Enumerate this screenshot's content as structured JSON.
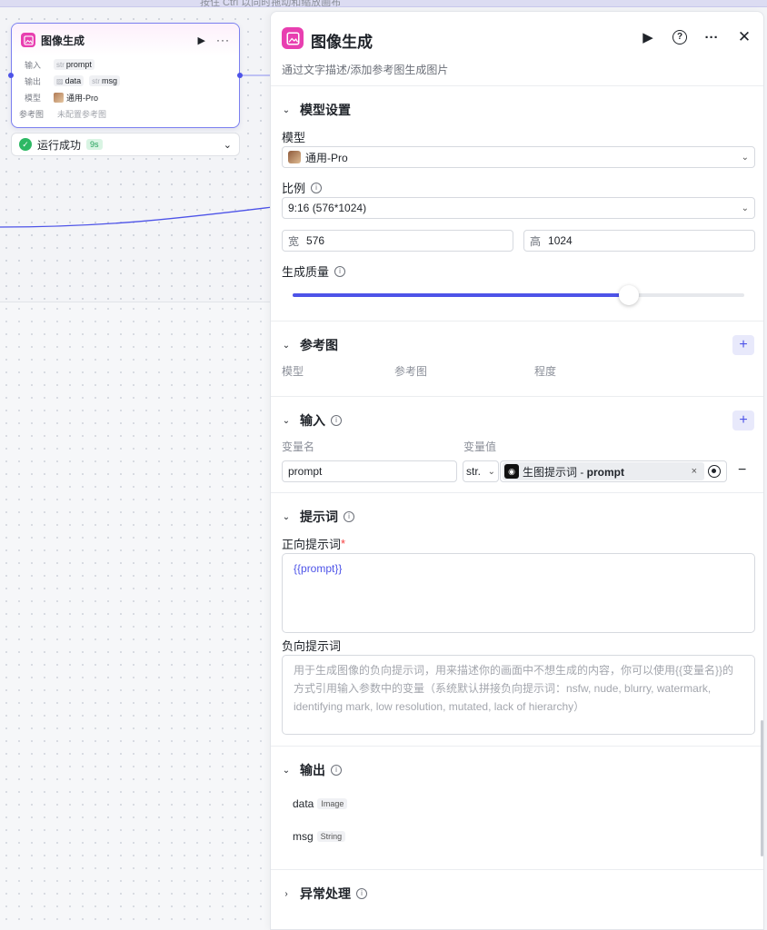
{
  "topbar": {
    "text": "按住 Ctrl 以同时拖动和缩放画布"
  },
  "node": {
    "title": "图像生成",
    "input_label": "输入",
    "input_tag_type": "str",
    "input_tag_name": "prompt",
    "output_label": "输出",
    "output_tag1_name": "data",
    "output_tag2_type": "str",
    "output_tag2_name": "msg",
    "model_label": "模型",
    "model_value": "通用-Pro",
    "ref_label": "参考图",
    "ref_value": "未配置参考图",
    "status_text": "运行成功",
    "status_time": "9s"
  },
  "panel": {
    "title": "图像生成",
    "description": "通过文字描述/添加参考图生成图片",
    "model_settings": {
      "title": "模型设置",
      "model_label": "模型",
      "model_value": "通用-Pro",
      "ratio_label": "比例",
      "ratio_value": "9:16 (576*1024)",
      "width_prefix": "宽",
      "width_value": "576",
      "height_prefix": "高",
      "height_value": "1024",
      "quality_label": "生成质量",
      "quality_fraction": 0.745
    },
    "reference": {
      "title": "参考图",
      "col_model": "模型",
      "col_image": "参考图",
      "col_degree": "程度"
    },
    "input": {
      "title": "输入",
      "col_name": "变量名",
      "col_value": "变量值",
      "var_name": "prompt",
      "var_type": "str.",
      "ref_name": "生图提示词 - ",
      "ref_var": "prompt"
    },
    "prompt": {
      "title": "提示词",
      "positive_label": "正向提示词",
      "required_mark": "*",
      "positive_value": "{{prompt}}",
      "negative_label": "负向提示词",
      "negative_placeholder": "用于生成图像的负向提示词，用来描述你的画面中不想生成的内容，你可以使用{{变量名}}的方式引用输入参数中的变量（系统默认拼接负向提示词：nsfw, nude, blurry, watermark, identifying mark, low resolution, mutated, lack of hierarchy）"
    },
    "output": {
      "title": "输出",
      "items": [
        {
          "name": "data",
          "type": "Image"
        },
        {
          "name": "msg",
          "type": "String"
        }
      ]
    },
    "exception": {
      "title": "异常处理"
    }
  },
  "colors": {
    "accent": "#4d53e8",
    "node_icon": "#e83fb0",
    "success": "#2db864"
  }
}
